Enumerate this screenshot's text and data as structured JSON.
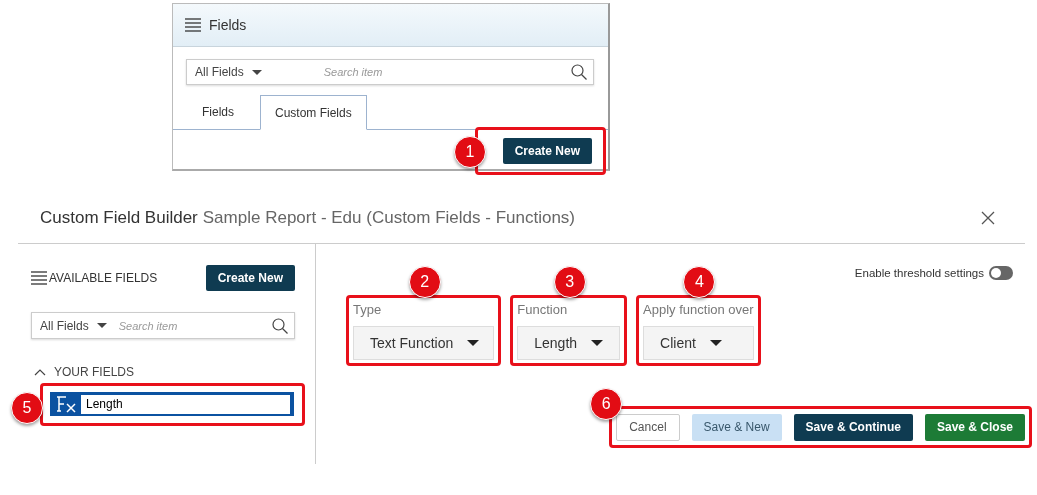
{
  "fields_panel": {
    "title": "Fields",
    "filter": "All Fields",
    "search": {
      "placeholder": "Search item"
    },
    "tabs": [
      {
        "label": "Fields",
        "selected": false
      },
      {
        "label": "Custom Fields",
        "selected": true
      }
    ],
    "create_button": "Create New",
    "callout": "1"
  },
  "dialog": {
    "title": "Custom Field Builder",
    "subtitle": "Sample Report - Edu (Custom Fields - Functions)"
  },
  "sidebar": {
    "heading": "AVAILABLE FIELDS",
    "create_button": "Create New",
    "filter": "All Fields",
    "search": {
      "placeholder": "Search item"
    },
    "section": {
      "label": "YOUR FIELDS",
      "expanded": true
    },
    "fields": [
      {
        "value": "Length",
        "callout": "5"
      }
    ]
  },
  "threshold": {
    "label": "Enable threshold settings",
    "on": false
  },
  "selects": [
    {
      "label": "Type",
      "value": "Text Function",
      "callout": "2"
    },
    {
      "label": "Function",
      "value": "Length",
      "callout": "3"
    },
    {
      "label": "Apply function over",
      "value": "Client",
      "callout": "4"
    }
  ],
  "buttons_callout": "6",
  "buttons": [
    {
      "label": "Cancel",
      "kind": "cancel"
    },
    {
      "label": "Save & New",
      "kind": "light"
    },
    {
      "label": "Save & Continue",
      "kind": "dark"
    },
    {
      "label": "Save & Close",
      "kind": "green"
    }
  ]
}
